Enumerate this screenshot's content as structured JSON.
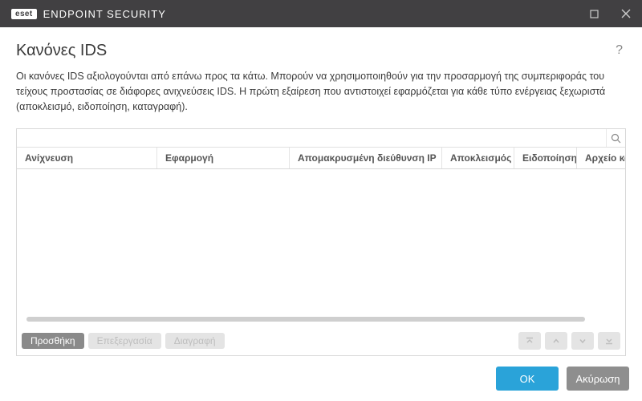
{
  "titlebar": {
    "brand_badge": "eset",
    "brand_text": "ENDPOINT SECURITY"
  },
  "page": {
    "heading": "Κανόνες IDS",
    "description": "Οι κανόνες IDS αξιολογούνται από επάνω προς τα κάτω. Μπορούν να χρησιμοποιηθούν για την προσαρμογή της συμπεριφοράς του τείχους προστασίας σε διάφορες ανιχνεύσεις IDS. Η πρώτη εξαίρεση που αντιστοιχεί εφαρμόζεται για κάθε τύπο ενέργειας ξεχωριστά (αποκλεισμό, ειδοποίηση, καταγραφή)."
  },
  "search": {
    "placeholder": ""
  },
  "table": {
    "columns": [
      "Ανίχνευση",
      "Εφαρμογή",
      "Απομακρυσμένη διεύθυνση IP",
      "Αποκλεισμός",
      "Ειδοποίηση",
      "Αρχείο κατα"
    ],
    "rows": []
  },
  "toolbar": {
    "add": "Προσθήκη",
    "edit": "Επεξεργασία",
    "delete": "Διαγραφή"
  },
  "footer": {
    "ok": "OK",
    "cancel": "Ακύρωση"
  }
}
